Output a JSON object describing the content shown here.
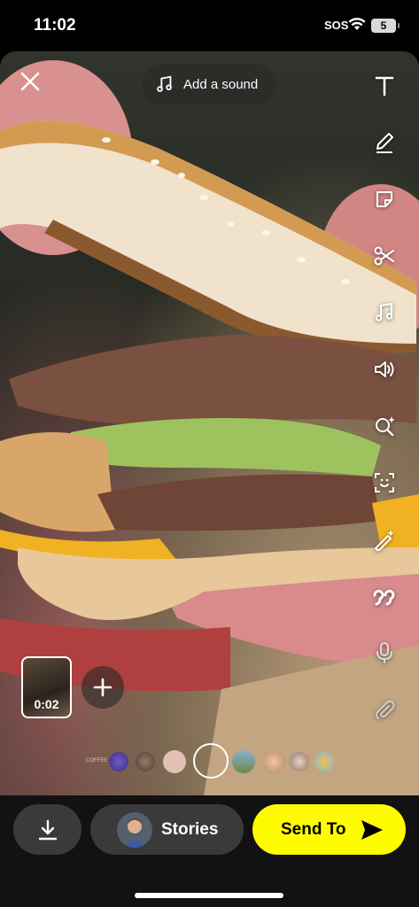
{
  "status_bar": {
    "time": "11:02",
    "sos": "SOS",
    "battery": "5"
  },
  "top": {
    "close_icon": "close-icon",
    "sound_label": "Add a sound",
    "sound_icon": "music-note-icon"
  },
  "toolbar": {
    "tools": [
      "text-tool-icon",
      "pencil-icon",
      "sticker-icon",
      "scissors-icon",
      "music-note-icon",
      "volume-icon",
      "lens-search-icon",
      "scan-icon",
      "magic-wand-icon",
      "quote-icon",
      "microphone-icon",
      "paperclip-icon"
    ]
  },
  "clip": {
    "duration": "0:02"
  },
  "lens_row": {
    "first_label": "COFFEE"
  },
  "bottom": {
    "stories_label": "Stories",
    "send_label": "Send To"
  },
  "colors": {
    "accent": "#fffc00",
    "button_bg": "#3a3a3a"
  }
}
